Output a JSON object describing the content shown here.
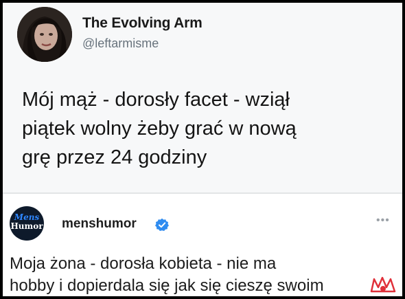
{
  "tweet": {
    "display_name": "The Evolving Arm",
    "handle": "@leftarmisme",
    "text_lines": [
      "Mój mąż - dorosły facet - wziął",
      "piątek wolny żeby grać w nową",
      "grę przez 24 godziny"
    ]
  },
  "post": {
    "avatar_logo_top": "Mens",
    "avatar_logo_bottom": "Humor",
    "username": "menshumor",
    "verified_icon": "verified-badge-icon",
    "more_icon": "more-options-icon",
    "more_label": "•••",
    "text_lines": [
      "Moja żona - dorosła kobieta - nie ma",
      "hobby i dopierdala się jak się cieszę swoim"
    ]
  },
  "colors": {
    "verified": "#2f8cf0",
    "watermark": "#e0303a"
  }
}
